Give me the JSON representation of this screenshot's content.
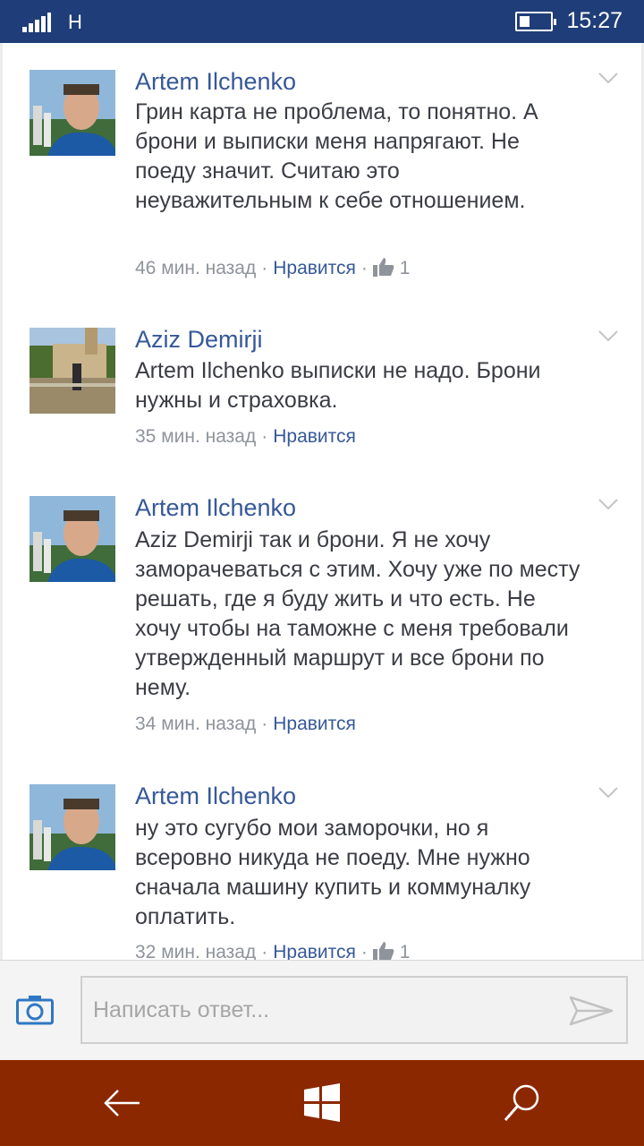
{
  "status_bar": {
    "network": "H",
    "time": "15:27",
    "battery_level": 0.3
  },
  "comments": [
    {
      "author": "Artem Ilchenko",
      "text": "Грин карта не проблема, то понятно. А брони и выписки меня напрягают. Не поеду значит. Считаю это неуважительным к себе отношением.",
      "time": "46 мин. назад",
      "like_label": "Нравится",
      "likes": "1",
      "avatar": "artem"
    },
    {
      "author": "Aziz  Demirji",
      "text": "Artem Ilchenko выписки не надо. Брони нужны и страховка.",
      "time": "35 мин. назад",
      "like_label": "Нравится",
      "likes": "",
      "avatar": "aziz"
    },
    {
      "author": "Artem Ilchenko",
      "text": "Aziz  Demirji так и брони. Я не хочу заморачеваться с этим. Хочу уже по месту решать, где я буду жить и что есть. Не хочу чтобы на таможне с меня требовали утвержденный маршрут и все брони по нему.",
      "time": "34 мин. назад",
      "like_label": "Нравится",
      "likes": "",
      "avatar": "artem"
    },
    {
      "author": "Artem Ilchenko",
      "text": "ну это сугубо мои заморочки, но я всеровно никуда не поеду. Мне нужно сначала машину купить  и коммуналку оплатить.",
      "time": "32 мин. назад",
      "like_label": "Нравится",
      "likes": "1",
      "avatar": "artem"
    }
  ],
  "reply": {
    "placeholder": "Написать ответ..."
  },
  "colors": {
    "status_bar": "#1f3d78",
    "author": "#365899",
    "nav_bar": "#8c2800"
  },
  "icons": [
    "camera-icon",
    "send-icon",
    "back-icon",
    "windows-icon",
    "search-icon",
    "thumbs-up-icon",
    "chevron-down-icon"
  ]
}
